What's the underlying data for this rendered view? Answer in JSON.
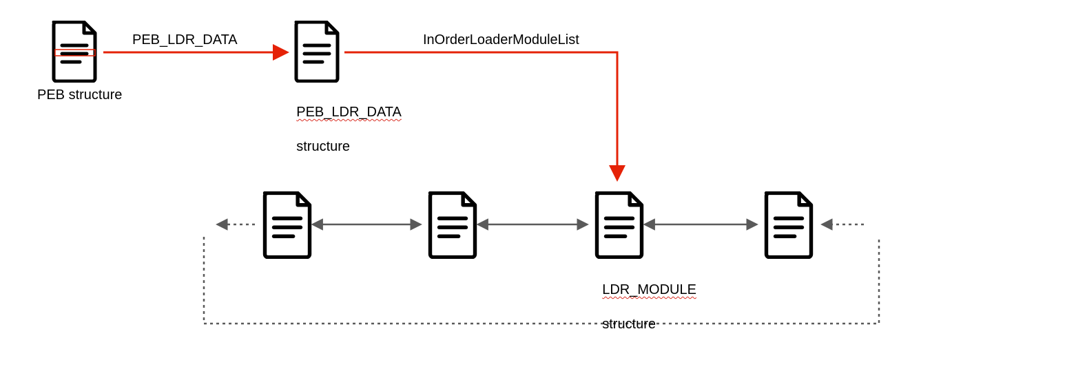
{
  "nodes": {
    "peb": {
      "label": "PEB structure"
    },
    "peb_ldr_data": {
      "label_line1": "PEB_LDR_DATA",
      "label_line2": "structure"
    },
    "ldr_module": {
      "label_line1": "LDR_MODULE",
      "label_line2": "structure"
    }
  },
  "edges": {
    "peb_to_ldr": {
      "label": "PEB_LDR_DATA"
    },
    "ldr_to_list": {
      "label": "InOrderLoaderModuleList"
    }
  },
  "colors": {
    "arrow_red": "#e52207",
    "arrow_gray": "#5a5a5a",
    "stroke": "#000000"
  }
}
